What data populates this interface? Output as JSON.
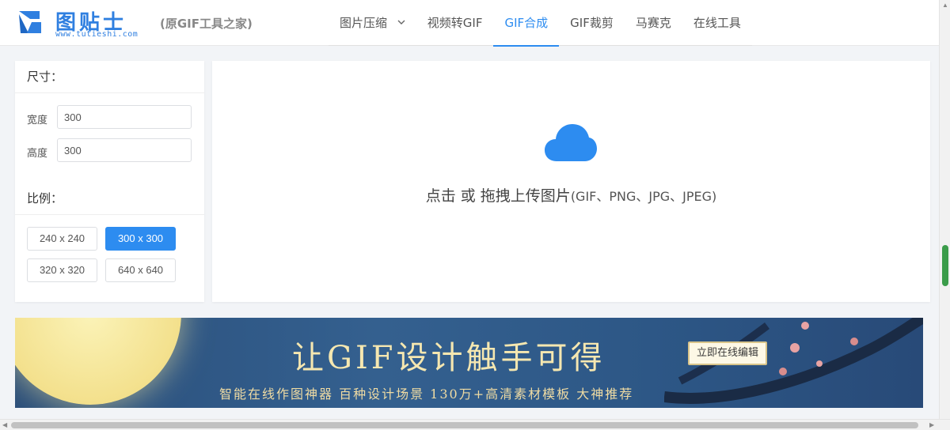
{
  "header": {
    "logo_text": "图贴士",
    "logo_url": "www.tutieshi.com",
    "logo_subtitle": "(原GIF工具之家)",
    "nav": [
      {
        "label": "图片压缩",
        "has_dropdown": true
      },
      {
        "label": "视频转GIF"
      },
      {
        "label": "GIF合成",
        "active": true
      },
      {
        "label": "GIF裁剪"
      },
      {
        "label": "马赛克"
      },
      {
        "label": "在线工具"
      }
    ]
  },
  "settings": {
    "size_title": "尺寸：",
    "width_label": "宽度",
    "width_value": "300",
    "height_label": "高度",
    "height_value": "300",
    "ratio_title": "比例：",
    "ratios": [
      "240 x 240",
      "300 x 300",
      "320 x 320",
      "640 x 640"
    ],
    "selected_ratio": "300 x 300"
  },
  "upload": {
    "prompt": "点击 或 拖拽上传图片",
    "formats": "(GIF、PNG、JPG、JPEG)",
    "icon": "cloud-upload-icon",
    "icon_color": "#2d8cf0"
  },
  "banner": {
    "title": "让GIF设计触手可得",
    "subtitle": "智能在线作图神器  百种设计场景 130万+高清素材模板  大神推荐",
    "button": "立即在线编辑"
  },
  "colors": {
    "accent": "#2d8cf0",
    "logo": "#2f7fe0"
  }
}
